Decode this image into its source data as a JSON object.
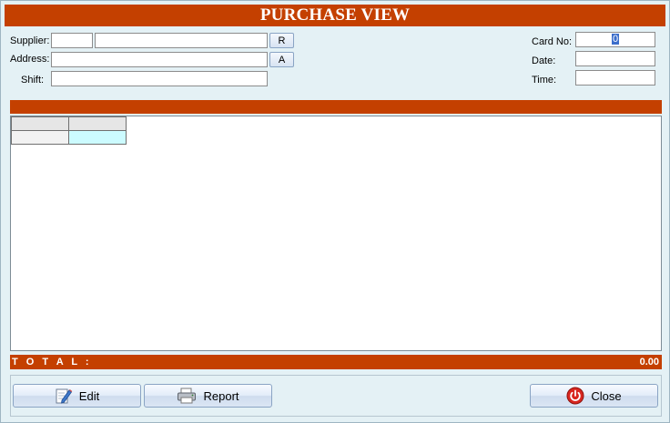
{
  "title": "PURCHASE VIEW",
  "form": {
    "supplier_label": "Supplier:",
    "address_label": "Address:",
    "shift_label": "Shift:",
    "card_no_label": "Card No:",
    "date_label": "Date:",
    "time_label": "Time:",
    "card_no_value": "0",
    "r_button": "R",
    "a_button": "A"
  },
  "total": {
    "label": "T O T A L :",
    "value": "0.00"
  },
  "buttons": {
    "edit": "Edit",
    "report": "Report",
    "close": "Close"
  },
  "colors": {
    "accent": "#c44000",
    "background": "#e4f1f5",
    "current_cell": "#ccfbff"
  },
  "icons": {
    "edit": "edit-pencil-icon",
    "report": "printer-icon",
    "close": "power-icon"
  }
}
